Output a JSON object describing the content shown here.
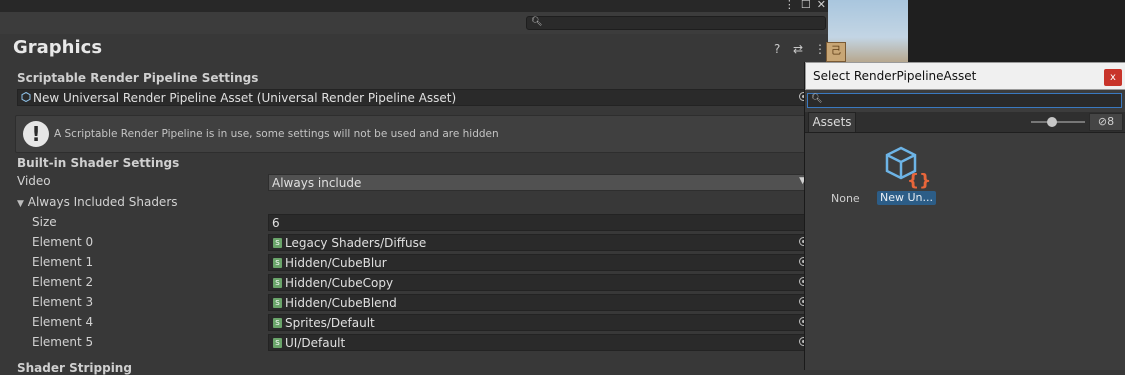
{
  "window": {
    "controls": [
      "⋮",
      "☐",
      "✕"
    ],
    "search_placeholder": ""
  },
  "inspector": {
    "title": "Graphics",
    "header_icons": [
      "help-icon",
      "settings-sliders-icon",
      "more-icon"
    ],
    "srp_section": "Scriptable Render Pipeline Settings",
    "srp_asset": "New Universal Render Pipeline Asset (Universal Render Pipeline Asset)",
    "help_text": "A Scriptable Render Pipeline is in use, some settings will not be used and are hidden",
    "builtin_section": "Built-in Shader Settings",
    "video_label": "Video",
    "video_value": "Always include",
    "always_included_label": "Always Included Shaders",
    "size_label": "Size",
    "size_value": "6",
    "elements": [
      {
        "label": "Element 0",
        "value": "Legacy Shaders/Diffuse"
      },
      {
        "label": "Element 1",
        "value": "Hidden/CubeBlur"
      },
      {
        "label": "Element 2",
        "value": "Hidden/CubeCopy"
      },
      {
        "label": "Element 3",
        "value": "Hidden/CubeBlend"
      },
      {
        "label": "Element 4",
        "value": "Sprites/Default"
      },
      {
        "label": "Element 5",
        "value": "UI/Default"
      }
    ],
    "stripping_section": "Shader Stripping"
  },
  "popup": {
    "title": "Select RenderPipelineAsset",
    "close_label": "x",
    "search_value": "",
    "tab_assets": "Assets",
    "hidden_count": "8",
    "none_label": "None",
    "asset_label": "New Un..."
  },
  "colors": {
    "selection": "#2c5d87",
    "close": "#c8342a",
    "accent": "#3a79c0"
  }
}
